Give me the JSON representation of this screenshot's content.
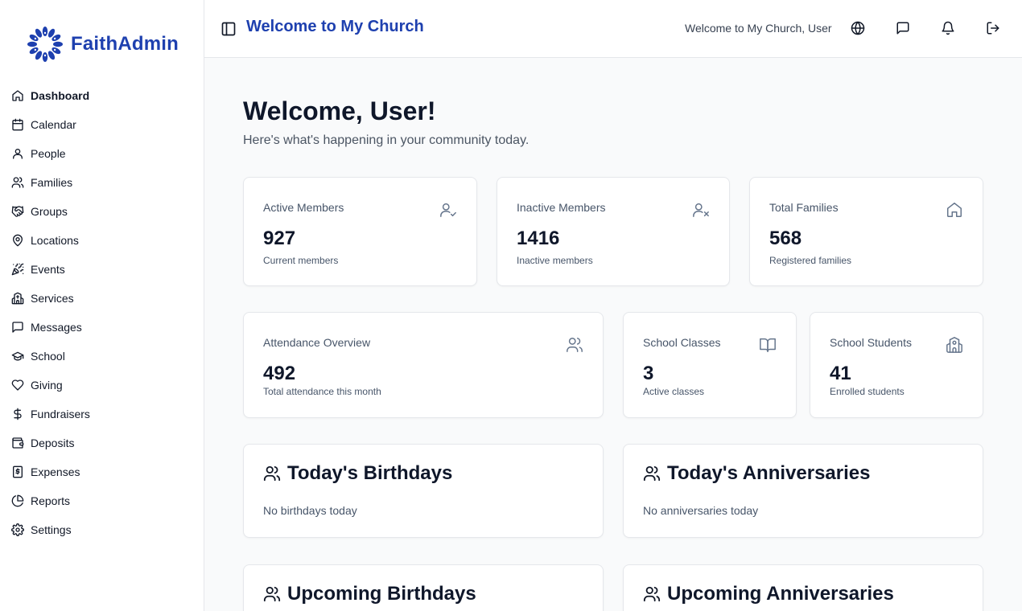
{
  "brand": {
    "name": "FaithAdmin",
    "logo_icon": "dove-ring-icon",
    "color": "#1e40af"
  },
  "sidebar": {
    "items": [
      {
        "label": "Dashboard",
        "icon": "home-icon",
        "active": true
      },
      {
        "label": "Calendar",
        "icon": "calendar-icon"
      },
      {
        "label": "People",
        "icon": "user-icon"
      },
      {
        "label": "Families",
        "icon": "users-icon"
      },
      {
        "label": "Groups",
        "icon": "handshake-icon"
      },
      {
        "label": "Locations",
        "icon": "map-pin-icon"
      },
      {
        "label": "Events",
        "icon": "party-popper-icon"
      },
      {
        "label": "Services",
        "icon": "church-icon"
      },
      {
        "label": "Messages",
        "icon": "message-square-icon"
      },
      {
        "label": "School",
        "icon": "graduation-cap-icon"
      },
      {
        "label": "Giving",
        "icon": "heart-icon"
      },
      {
        "label": "Fundraisers",
        "icon": "dollar-sign-icon"
      },
      {
        "label": "Deposits",
        "icon": "wallet-icon"
      },
      {
        "label": "Expenses",
        "icon": "receipt-icon"
      },
      {
        "label": "Reports",
        "icon": "pie-chart-icon"
      },
      {
        "label": "Settings",
        "icon": "gear-icon"
      }
    ]
  },
  "header": {
    "title": "Welcome to My Church",
    "welcome_text": "Welcome to My Church, User"
  },
  "main": {
    "title": "Welcome, User!",
    "subtitle": "Here's what's happening in your community today.",
    "stats_row1": [
      {
        "label": "Active Members",
        "value": "927",
        "note": "Current members",
        "icon": "user-check-icon"
      },
      {
        "label": "Inactive Members",
        "value": "1416",
        "note": "Inactive members",
        "icon": "user-x-icon"
      },
      {
        "label": "Total Families",
        "value": "568",
        "note": "Registered families",
        "icon": "home-icon"
      }
    ],
    "stats_row2": [
      {
        "label": "Attendance Overview",
        "value": "492",
        "note": "Total attendance this month",
        "icon": "users-icon"
      },
      {
        "label": "School Classes",
        "value": "3",
        "note": "Active classes",
        "icon": "book-open-icon"
      },
      {
        "label": "School Students",
        "value": "41",
        "note": "Enrolled students",
        "icon": "school-icon"
      }
    ],
    "events": [
      {
        "title": "Today's Birthdays",
        "empty": "No birthdays today"
      },
      {
        "title": "Today's Anniversaries",
        "empty": "No anniversaries today"
      },
      {
        "title": "Upcoming Birthdays"
      },
      {
        "title": "Upcoming Anniversaries"
      }
    ]
  }
}
